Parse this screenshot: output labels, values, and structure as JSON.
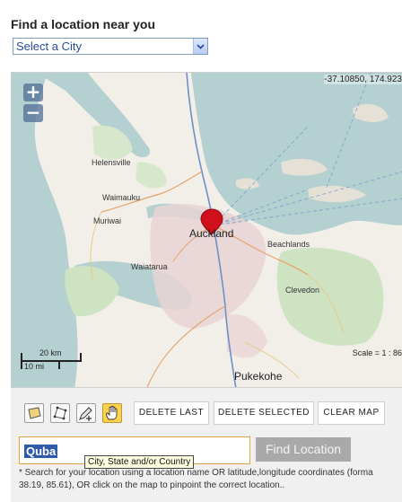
{
  "header": {
    "title": "Find a location near you"
  },
  "city_select": {
    "selected": "Select a City"
  },
  "map": {
    "coordinates_readout": "-37.10850, 174.923",
    "scale_ratio": "Scale = 1 : 86",
    "scale_km": "20 km",
    "scale_mi": "10 mi",
    "zoom_in": "+",
    "zoom_out": "−",
    "places": {
      "helensville": "Helensville",
      "waimauku": "Waimauku",
      "muriwai": "Muriwai",
      "auckland": "Auckland",
      "beachlands": "Beachlands",
      "waiatarua": "Waiatarua",
      "clevedon": "Clevedon",
      "pukekohe": "Pukekohe"
    },
    "colors": {
      "sea": "#b5d0d0",
      "land": "#f2efe9",
      "urban": "#e8d4d4",
      "marker": "#d0101a"
    }
  },
  "toolbar": {
    "tools": [
      "rectangle-select-tool",
      "polygon-select-tool",
      "add-point-tool",
      "pan-hand-tool"
    ],
    "active_tool": "pan-hand-tool",
    "delete_last": "DELETE LAST",
    "delete_selected": "DELETE SELECTED",
    "clear_map": "CLEAR MAP"
  },
  "search": {
    "value": "Quba",
    "tooltip": "City, State and/or Country",
    "find_button": "Find Location",
    "hint_line1": "* Search for your location using a location name OR latitude,longitude coordinates (forma",
    "hint_line2": "38.19, 85.61), OR click on the map to pinpoint the correct location.."
  }
}
